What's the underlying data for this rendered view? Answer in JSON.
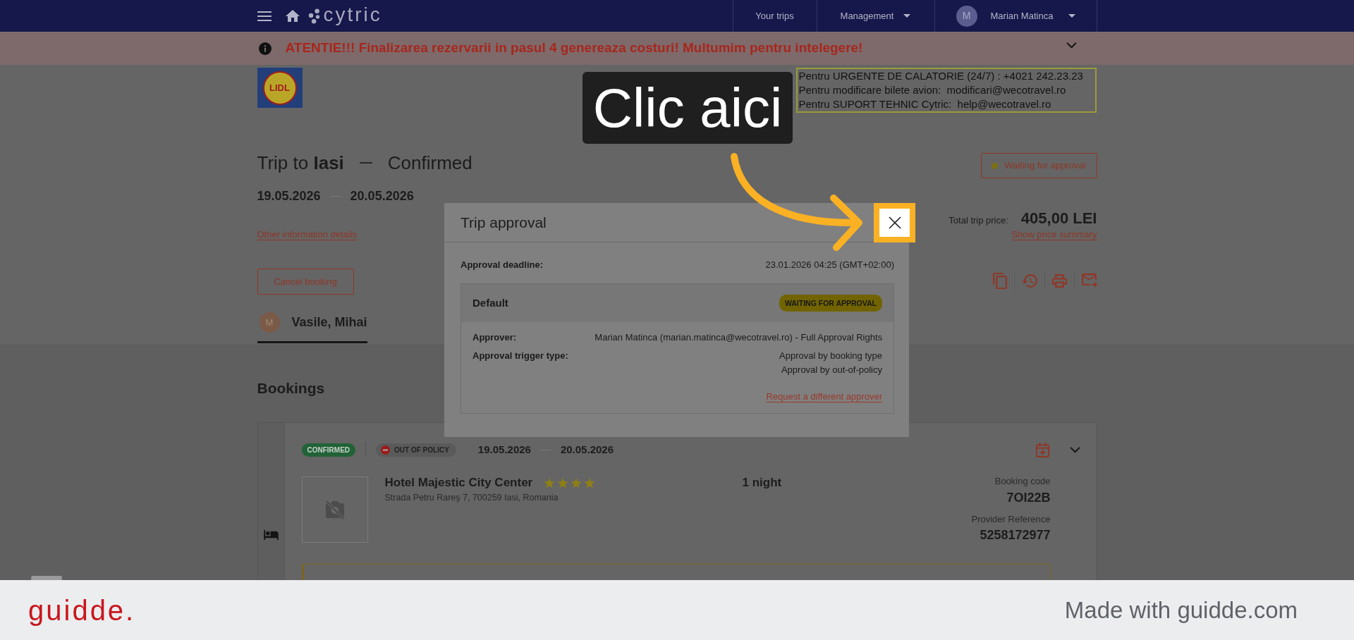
{
  "nav": {
    "logo_text": "cytric",
    "items": [
      {
        "label": "Your trips",
        "kind": "link"
      },
      {
        "label": "Management",
        "kind": "dropdown"
      }
    ],
    "user": {
      "initial": "M",
      "name": "Marian Matinca"
    }
  },
  "banner": {
    "text": "ATENTIE!!! Finalizarea rezervarii in pasul 4 genereaza costuri! Multumim pentru intelegere!"
  },
  "company_logo": {
    "text": "LIDL"
  },
  "contact_box": {
    "lines": [
      "Pentru URGENTE DE CALATORIE (24/7) : +4021 242.23.23",
      "Pentru modificare bilete avion:  modificari@wecotravel.ro",
      "Pentru SUPORT TEHNIC Cytric:  help@wecotravel.ro"
    ]
  },
  "trip": {
    "title": "Trip to **Iasi**",
    "status": "Confirmed",
    "start_date": "19.05.2026",
    "end_date": "20.05.2026",
    "details_link": "Other information details",
    "cancel_button": "Cancel booking",
    "approval_status": "Waiting for approval",
    "price_label": "Total trip price:",
    "price": "405,00 LEI",
    "price_link": "Show price summary"
  },
  "travelers": [
    {
      "initial": "M",
      "name": "Vasile, Mihai",
      "selected": true
    }
  ],
  "bookings": {
    "heading": "Bookings",
    "items": [
      {
        "kind": "hotel",
        "badges": [
          {
            "text": "CONFIRMED",
            "kind": "confirmed"
          },
          {
            "text": "OUT OF POLICY",
            "kind": "out_of_policy"
          }
        ],
        "start_date": "19.05.2026",
        "end_date": "20.05.2026",
        "name": "Hotel Majestic City Center",
        "stars": 4,
        "address": "Strada Petru Rareş 7, 700259 Iasi, Romania",
        "duration": "1 night",
        "code_label": "Booking code",
        "code": "7OI22B",
        "reference_label": "Provider Reference",
        "reference": "5258172977"
      }
    ]
  },
  "modal": {
    "title": "Trip approval",
    "deadline_label": "Approval deadline:",
    "deadline": "23.01.2026 04:25 (GMT+02:00)",
    "approvals": [
      {
        "name": "Default",
        "status": "WAITING FOR APPROVAL",
        "rows": [
          {
            "label": "Approver:",
            "values": [
              "Marian Matinca (marian.matinca@wecotravel.ro) - Full Approval Rights"
            ]
          },
          {
            "label": "Approval trigger type:",
            "values": [
              "Approval by booking type",
              "Approval by out-of-policy"
            ]
          }
        ],
        "link": "Request a different approver"
      }
    ]
  },
  "callout": {
    "text": "Clic aici"
  },
  "footer": {
    "logo_text": "guidde.",
    "credit": "Made with guidde.com"
  }
}
